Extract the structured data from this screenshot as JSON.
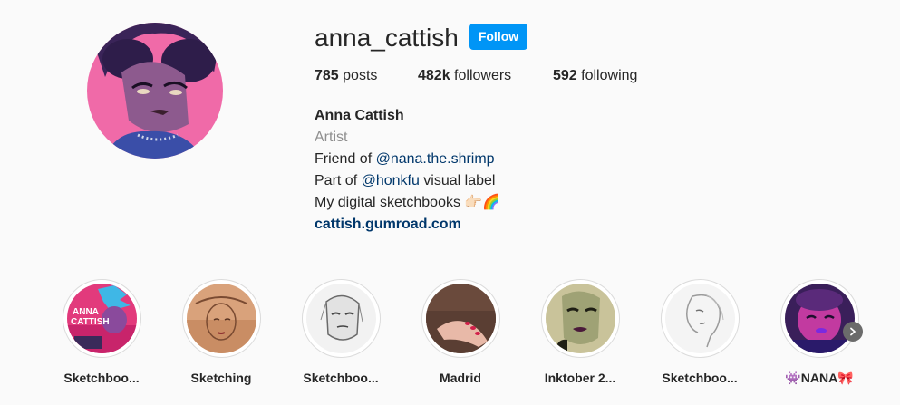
{
  "profile": {
    "username": "anna_cattish",
    "follow_label": "Follow",
    "stats": [
      {
        "count": "785",
        "label": "posts"
      },
      {
        "count": "482k",
        "label": "followers"
      },
      {
        "count": "592",
        "label": "following"
      }
    ],
    "bio": {
      "name": "Anna Cattish",
      "category": "Artist",
      "line1_prefix": "Friend of ",
      "line1_mention": "@nana.the.shrimp",
      "line2_prefix": "Part of ",
      "line2_mention": "@honkfu",
      "line2_suffix": " visual label",
      "line3": "My digital sketchbooks 👉🏻🌈",
      "website": "cattish.gumroad.com"
    }
  },
  "highlights": [
    {
      "title": "Sketchboo...",
      "icon": "pink-blue-art-thumbnail"
    },
    {
      "title": "Sketching",
      "icon": "sketch-face-thumbnail"
    },
    {
      "title": "Sketchboo...",
      "icon": "pencil-face-thumbnail"
    },
    {
      "title": "Madrid",
      "icon": "hand-photo-thumbnail"
    },
    {
      "title": "Inktober 2...",
      "icon": "green-face-thumbnail"
    },
    {
      "title": "Sketchboo...",
      "icon": "line-portrait-thumbnail"
    },
    {
      "title": "👾NANA🎀",
      "icon": "purple-character-thumbnail"
    }
  ],
  "next_icon": "chevron-right-icon",
  "colors": {
    "accent": "#0095f6",
    "link": "#00376b",
    "muted": "#8e8e8e"
  }
}
